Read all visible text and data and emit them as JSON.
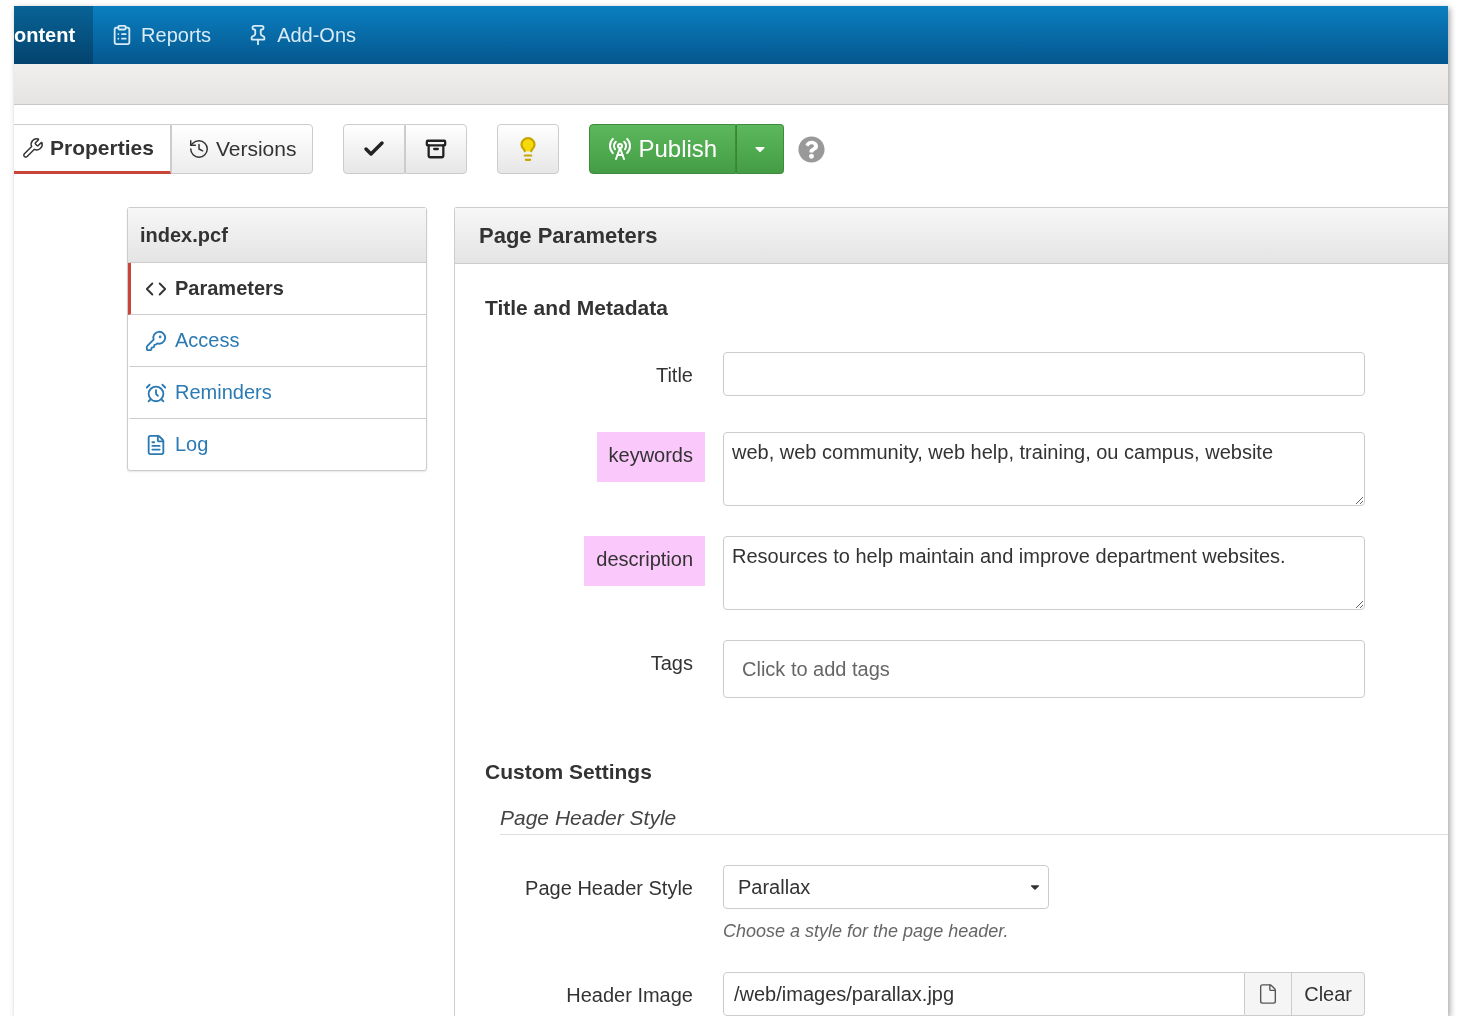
{
  "nav": [
    {
      "label": "ontent",
      "selected": true
    },
    {
      "label": "Reports",
      "selected": false
    },
    {
      "label": "Add-Ons",
      "selected": false
    }
  ],
  "toolbar": {
    "tabs": [
      {
        "label": "Properties",
        "selected": true
      },
      {
        "label": "Versions",
        "selected": false
      }
    ],
    "publish": {
      "label": "Publish"
    }
  },
  "sidebar": {
    "title": "index.pcf",
    "items": [
      {
        "label": "Parameters",
        "selected": true
      },
      {
        "label": "Access",
        "selected": false
      },
      {
        "label": "Reminders",
        "selected": false
      },
      {
        "label": "Log",
        "selected": false
      }
    ]
  },
  "panel": {
    "title": "Page Parameters",
    "sections": [
      {
        "heading": "Title and Metadata",
        "fields": [
          {
            "label": "Title",
            "kind": "text",
            "highlighted": false
          },
          {
            "label": "keywords",
            "kind": "textarea",
            "highlighted": true,
            "value": "web, web community, web help, training, ou campus, website"
          },
          {
            "label": "description",
            "kind": "textarea",
            "highlighted": true,
            "value": "Resources to help maintain and improve department websites."
          },
          {
            "label": "Tags",
            "kind": "tags",
            "highlighted": false,
            "placeholder": "Click to add tags"
          }
        ]
      },
      {
        "heading": "Custom Settings",
        "subheading": "Page Header Style",
        "fields": [
          {
            "label": "Page Header Style",
            "kind": "select",
            "highlighted": false,
            "value": "Parallax",
            "help": "Choose a style for the page header."
          },
          {
            "label": "Header Image",
            "kind": "file",
            "highlighted": false,
            "value": "/web/images/parallax.jpg",
            "button": "Clear"
          }
        ]
      }
    ]
  }
}
